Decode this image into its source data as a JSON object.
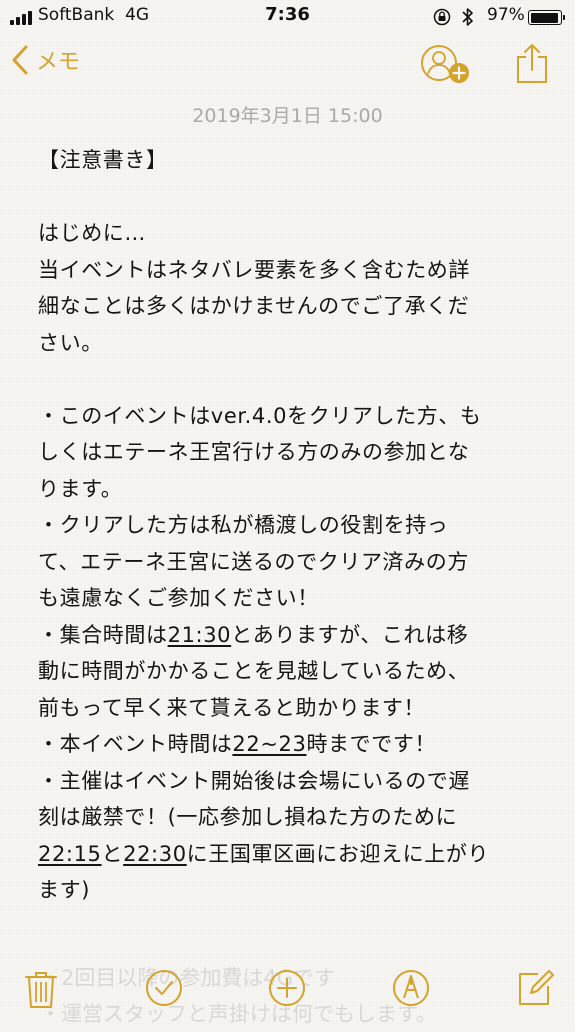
{
  "status_bar": {
    "carrier": "SoftBank",
    "network": "4G",
    "time": "7:36",
    "battery_percent": "97%",
    "battery_level": 0.97
  },
  "nav": {
    "back_label": "メモ",
    "icons": {
      "add_person": "person-add-icon",
      "share": "share-icon"
    }
  },
  "note": {
    "date": "2019年3月1日 15:00",
    "lines": [
      [
        "【注意書き】"
      ],
      [
        ""
      ],
      [
        "はじめに…"
      ],
      [
        "当イベントはネタバレ要素を多く含むため詳"
      ],
      [
        "細なことは多くはかけませんのでご了承くだ"
      ],
      [
        "さい。"
      ],
      [
        ""
      ],
      [
        "・このイベントはver.4.0をクリアした方、も"
      ],
      [
        "しくはエテーネ王宮行ける方のみの参加とな"
      ],
      [
        "ります。"
      ],
      [
        "・クリアした方は私が橋渡しの役割を持っ"
      ],
      [
        "て、エテーネ王宮に送るのでクリア済みの方"
      ],
      [
        "も遠慮なくご参加ください！"
      ],
      [
        "・集合時間は",
        "21:30",
        "とありますが、これは移"
      ],
      [
        "動に時間がかかることを見越しているため、"
      ],
      [
        "前もって早く来て貰えると助かります！"
      ],
      [
        "・本イベント時間は",
        "22~23",
        "時までです！"
      ],
      [
        "・主催はイベント開始後は会場にいるので遅"
      ],
      [
        "刻は厳禁で！(一応参加し損ねた方のために"
      ],
      [
        "",
        "22:15",
        "と",
        "22:30",
        "に王国軍区画にお迎えに上がり"
      ],
      [
        "ます)"
      ]
    ],
    "faded_lines": [
      "・2回目以降の参加費は4Gです",
      "・運営スタッフと声掛けは何でもします。"
    ]
  },
  "toolbar": {
    "icons": [
      "trash-icon",
      "checklist-icon",
      "add-icon",
      "markup-icon",
      "compose-icon"
    ]
  },
  "colors": {
    "accent": "#d5a22c",
    "date": "#a9a9a9",
    "text": "#151515"
  }
}
